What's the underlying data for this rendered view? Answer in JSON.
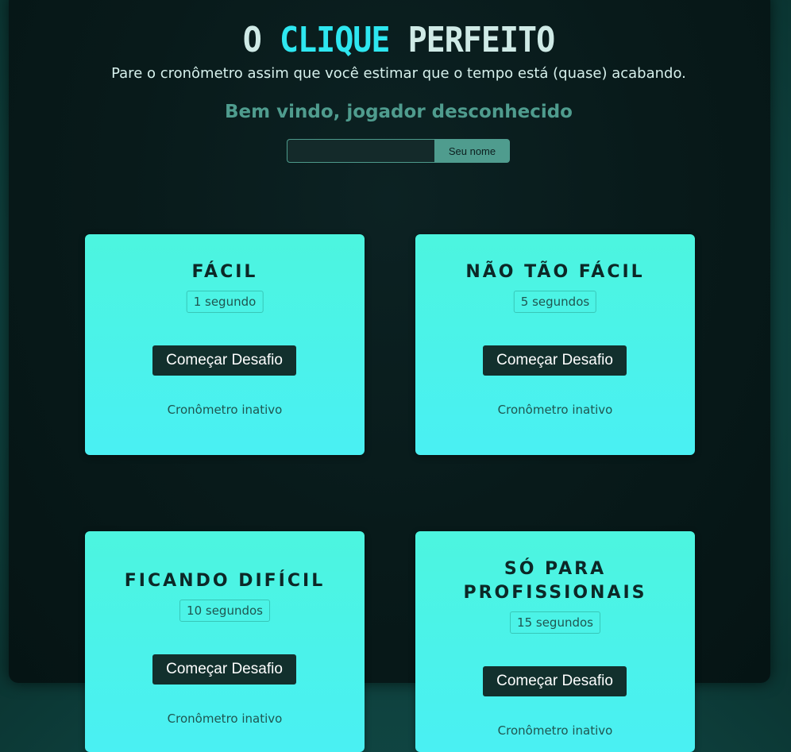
{
  "header": {
    "title_prefix": "O",
    "title_accent": "CLIQUE",
    "title_suffix": "PERFEITO",
    "subtitle": "Pare o cronômetro assim que você estimar que o tempo está (quase) acabando.",
    "welcome": "Bem vindo, jogador desconhecido"
  },
  "player_form": {
    "input_value": "",
    "input_placeholder": "",
    "button_label": "Seu nome"
  },
  "challenges": [
    {
      "title": "FÁCIL",
      "time": "1 segundo",
      "button_label": "Começar Desafio",
      "status": "Cronômetro inativo"
    },
    {
      "title": "NÃO TÃO FÁCIL",
      "time": "5 segundos",
      "button_label": "Começar Desafio",
      "status": "Cronômetro inativo"
    },
    {
      "title": "FICANDO DIFÍCIL",
      "time": "10 segundos",
      "button_label": "Começar Desafio",
      "status": "Cronômetro inativo"
    },
    {
      "title_line1": "SÓ PARA",
      "title_line2": "PROFISSIONAIS",
      "time": "15 segundos",
      "button_label": "Começar Desafio",
      "status": "Cronômetro inativo"
    }
  ],
  "colors": {
    "accent": "#2ee7f0",
    "welcome": "#4f9c8e",
    "card_top": "#4cf5df",
    "card_bottom": "#4af0f3",
    "button_bg": "#12302d"
  }
}
